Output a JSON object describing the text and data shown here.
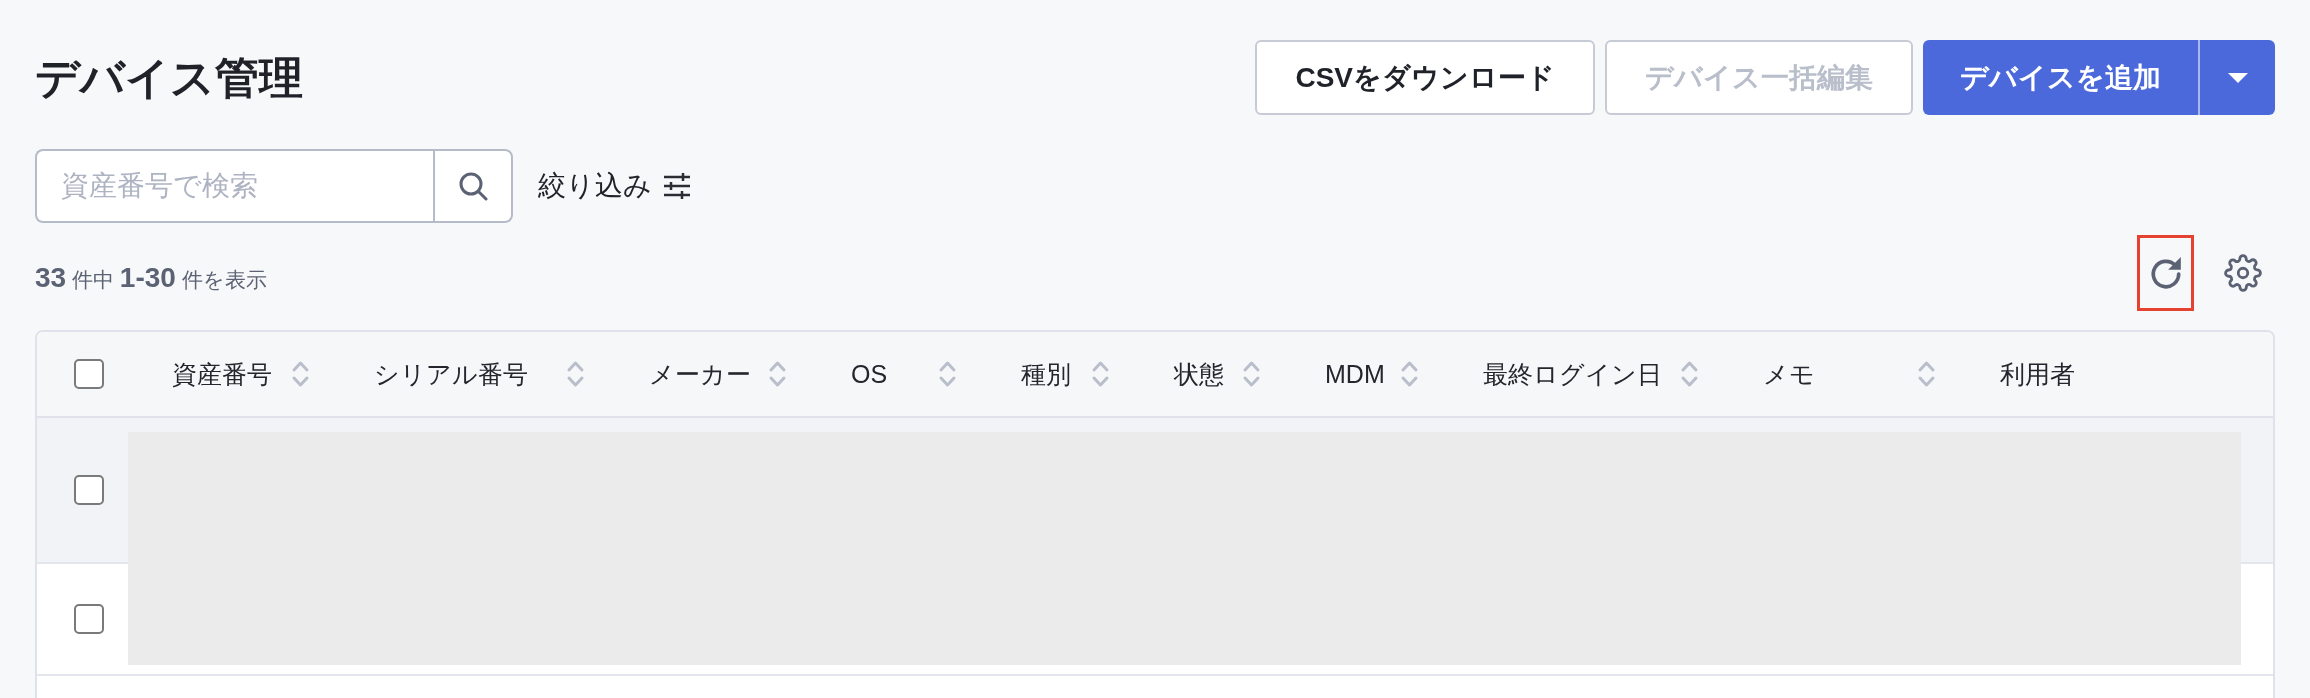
{
  "page": {
    "title": "デバイス管理"
  },
  "actions": [
    {
      "label": "CSVをダウンロード",
      "kind": "secondary",
      "disabled": false
    },
    {
      "label": "デバイス一括編集",
      "kind": "secondary",
      "disabled": true
    },
    {
      "label": "デバイスを追加",
      "kind": "primary",
      "disabled": false,
      "has_menu": true
    }
  ],
  "search": {
    "placeholder": "資産番号で検索"
  },
  "filter": {
    "label": "絞り込み"
  },
  "result_count": "**33** 件中 **1-30** 件を表示",
  "toolbar": [
    {
      "kind": "refresh",
      "highlighted": true
    },
    {
      "kind": "settings",
      "highlighted": false
    }
  ],
  "table": {
    "header_checked": false,
    "columns": [
      {
        "label": "資産番号",
        "sortable": true
      },
      {
        "label": "シリアル番号",
        "sortable": true
      },
      {
        "label": "メーカー",
        "sortable": true
      },
      {
        "label": "OS",
        "sortable": true
      },
      {
        "label": "種別",
        "sortable": true
      },
      {
        "label": "状態",
        "sortable": true
      },
      {
        "label": "MDM",
        "sortable": true
      },
      {
        "label": "最終ログイン日",
        "sortable": true
      },
      {
        "label": "メモ",
        "sortable": true
      },
      {
        "label": "利用者",
        "sortable": false
      }
    ],
    "loading": true,
    "rows": [
      {
        "checked": false,
        "hovered": true
      },
      {
        "checked": false,
        "hovered": false
      }
    ]
  }
}
